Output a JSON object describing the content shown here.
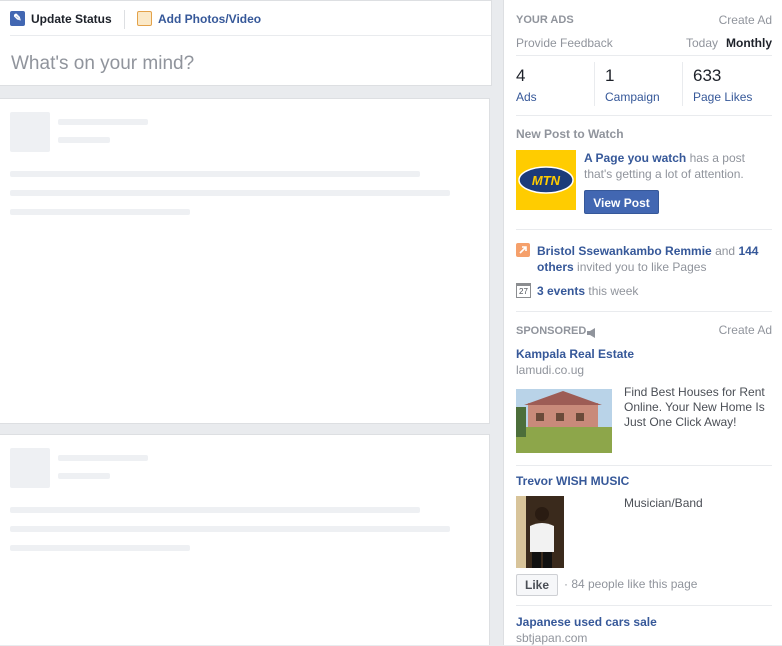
{
  "composer": {
    "tab_status": "Update Status",
    "tab_photos": "Add Photos/Video",
    "placeholder": "What's on your mind?"
  },
  "your_ads": {
    "heading": "YOUR ADS",
    "create_ad": "Create Ad",
    "feedback": "Provide Feedback",
    "today": "Today",
    "monthly": "Monthly",
    "stats": [
      {
        "value": "4",
        "label": "Ads"
      },
      {
        "value": "1",
        "label": "Campaign"
      },
      {
        "value": "633",
        "label": "Page Likes"
      }
    ]
  },
  "new_post": {
    "heading": "New Post to Watch",
    "logo_text": "MTN",
    "page_link": "A Page you watch",
    "text_1": "has a post",
    "text_2": "that's getting a lot of attention.",
    "button": "View Post"
  },
  "invites": {
    "name": "Bristol Ssewankambo Remmie",
    "and": "and",
    "count": "144",
    "others": "others",
    "rest": "invited you to like Pages",
    "calendar_day": "27",
    "events": "3 events",
    "events_rest": "this week"
  },
  "sponsored": {
    "heading": "SPONSORED",
    "create_ad": "Create Ad",
    "ad1": {
      "title": "Kampala Real Estate",
      "domain": "lamudi.co.ug",
      "body_1": "Find Best Houses for Rent",
      "body_2": "Online. Your New Home Is",
      "body_3": "Just One Click Away!"
    },
    "ad2": {
      "title": "Trevor WISH MUSIC",
      "category": "Musician/Band",
      "like_button": "Like",
      "likes_text": "· 84 people like this page"
    },
    "ad3": {
      "title": "Japanese used cars sale",
      "domain": "sbtjapan.com"
    }
  }
}
